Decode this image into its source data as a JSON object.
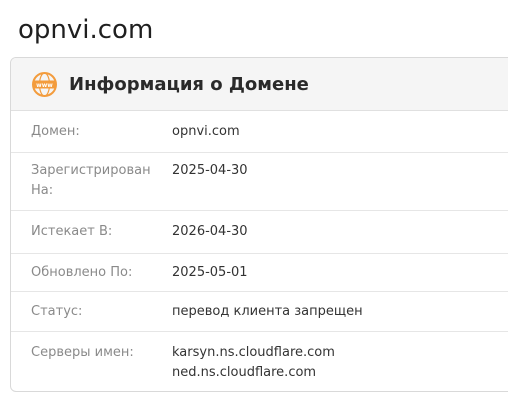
{
  "site": {
    "title": "opnvi.com"
  },
  "card": {
    "icon": "www-globe-icon",
    "title": "Информация о Домене",
    "accent_color": "#f39c3d"
  },
  "rows": [
    {
      "label": "Домен:",
      "value": "opnvi.com"
    },
    {
      "label": "Зарегистрирован На:",
      "value": "2025-04-30"
    },
    {
      "label": "Истекает В:",
      "value": "2026-04-30"
    },
    {
      "label": "Обновлено По:",
      "value": "2025-05-01"
    },
    {
      "label": "Статус:",
      "value": "перевод клиента запрещен"
    },
    {
      "label": "Серверы имен:",
      "values": [
        "karsyn.ns.cloudflare.com",
        "ned.ns.cloudflare.com"
      ]
    }
  ]
}
